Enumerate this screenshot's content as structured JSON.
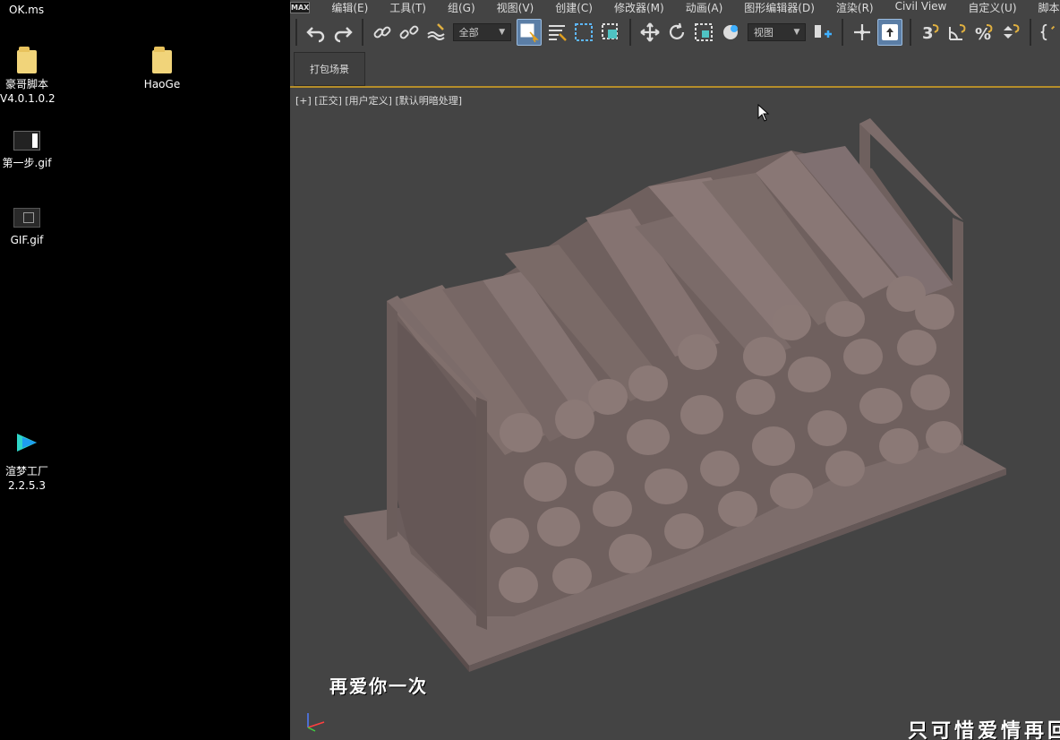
{
  "desktop": {
    "top_file": "OK.ms",
    "icons": [
      {
        "label_line1": "豪哥脚本",
        "label_line2": "V4.0.1.0.2",
        "icon": "folder-icon"
      },
      {
        "label_line1": "HaoGe",
        "label_line2": "",
        "icon": "folder-icon"
      },
      {
        "label_line1": "第一步.gif",
        "label_line2": "",
        "icon": "gif-file-icon"
      },
      {
        "label_line1": "GIF.gif",
        "label_line2": "",
        "icon": "gif-file-icon"
      },
      {
        "label_line1": "渲梦工厂",
        "label_line2": "2.2.5.3",
        "icon": "render-app-icon"
      }
    ]
  },
  "app": {
    "logo": "MAX",
    "menu": [
      "编辑(E)",
      "工具(T)",
      "组(G)",
      "视图(V)",
      "创建(C)",
      "修改器(M)",
      "动画(A)",
      "图形编辑器(D)",
      "渲染(R)",
      "Civil View",
      "自定义(U)",
      "脚本(S)"
    ],
    "toolbar": {
      "selection_filter": "全部",
      "ref_coord": "视图"
    },
    "ribbon": {
      "pack_scene": "打包场景"
    },
    "viewport": {
      "label": "[+] [正交] [用户定义] [默认明暗处理]",
      "subtitle_left": "再爱你一次",
      "subtitle_right": "只可惜爱情再回"
    }
  },
  "colors": {
    "model_fill": "#7a6a68",
    "model_shadow": "#5e504f",
    "viewport_bg": "#444444",
    "active_button": "#5b7ea6"
  }
}
